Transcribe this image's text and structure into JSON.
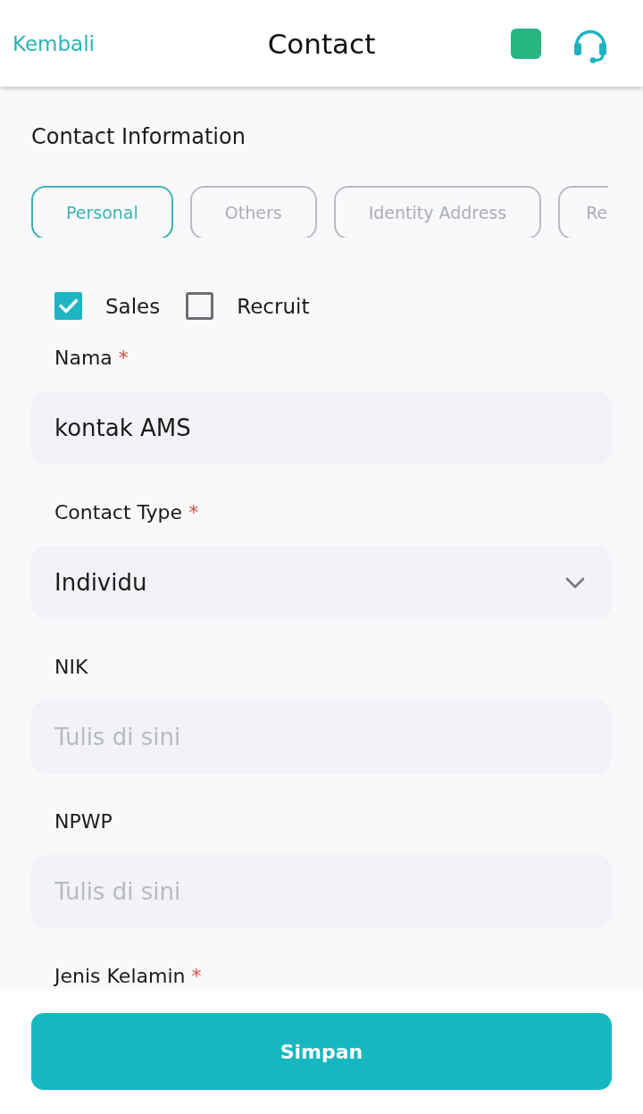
{
  "header": {
    "back_link": "Kembali",
    "title": "Contact"
  },
  "section_title": "Contact Information",
  "tabs": [
    {
      "label": "Personal",
      "selected": true
    },
    {
      "label": "Others",
      "selected": false
    },
    {
      "label": "Identity Address",
      "selected": false
    },
    {
      "label": "Re",
      "selected": false
    }
  ],
  "checkboxes": [
    {
      "label": "Sales",
      "checked": true
    },
    {
      "label": "Recruit",
      "checked": false
    }
  ],
  "fields": [
    {
      "kind": "text",
      "label": "Nama",
      "required_mark": "*",
      "value": "kontak AMS"
    },
    {
      "kind": "select",
      "label": "Contact Type",
      "required_mark": "*",
      "value": "Individu"
    },
    {
      "kind": "text",
      "label": "NIK",
      "placeholder": "Tulis di sini"
    },
    {
      "kind": "text",
      "label": "NPWP",
      "placeholder": "Tulis di sini"
    },
    {
      "kind": "label",
      "label": "Jenis Kelamin",
      "required_mark": "*"
    }
  ],
  "save_button": "Simpan"
}
